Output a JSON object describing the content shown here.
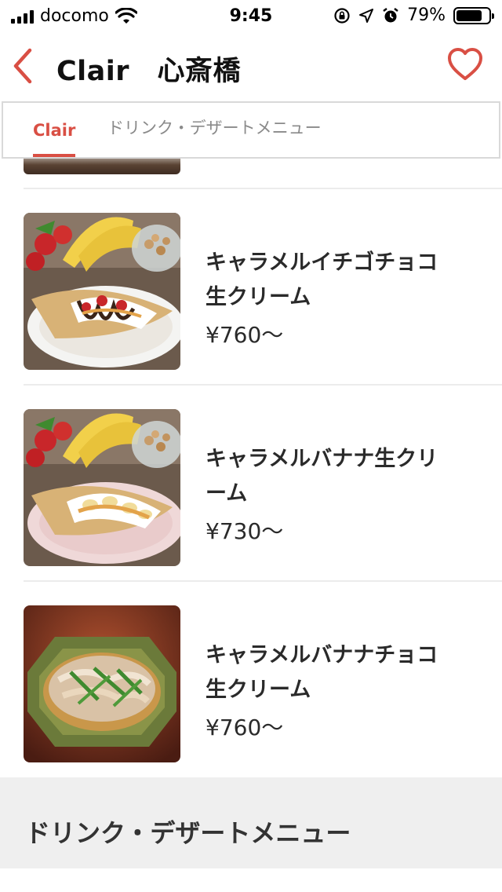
{
  "status_bar": {
    "carrier": "docomo",
    "time": "9:45",
    "battery_percent": "79%",
    "battery_level": 0.79
  },
  "header": {
    "title": "Clair　心斎橋",
    "back_icon": "chevron-left-icon",
    "favorite_icon": "heart-outline-icon",
    "accent_color": "#d94f44"
  },
  "tabs": [
    {
      "label": "Clair",
      "active": true
    },
    {
      "label": "ドリンク・デザートメニュー",
      "active": false
    }
  ],
  "menu_items": [
    {
      "name": "キャラメルイチゴチョコ生クリーム",
      "price": "¥760〜",
      "image": "crepe-strawberry-chocolate-photo"
    },
    {
      "name": "キャラメルバナナ生クリーム",
      "price": "¥730〜",
      "image": "crepe-banana-caramel-photo"
    },
    {
      "name": "キャラメルバナナチョコ生クリーム",
      "price": "¥760〜",
      "image": "noodle-dish-photo"
    }
  ],
  "section": {
    "title": "ドリンク・デザートメニュー"
  }
}
